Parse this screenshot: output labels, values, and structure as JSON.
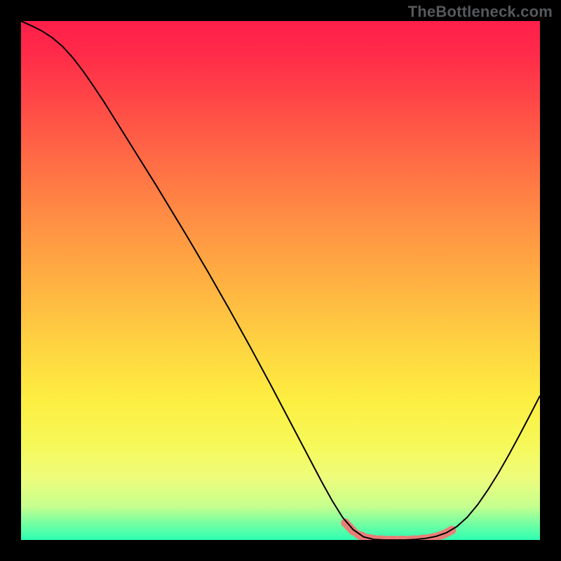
{
  "watermark": "TheBottleneck.com",
  "chart_data": {
    "type": "line",
    "title": "",
    "xlabel": "",
    "ylabel": "",
    "x": [
      0.0,
      0.02,
      0.04,
      0.06,
      0.08,
      0.1,
      0.12,
      0.14,
      0.16,
      0.18,
      0.2,
      0.22,
      0.24,
      0.26,
      0.28,
      0.3,
      0.32,
      0.34,
      0.36,
      0.38,
      0.4,
      0.42,
      0.44,
      0.46,
      0.48,
      0.5,
      0.52,
      0.54,
      0.56,
      0.58,
      0.6,
      0.62,
      0.64,
      0.66,
      0.68,
      0.7,
      0.72,
      0.74,
      0.76,
      0.78,
      0.8,
      0.82,
      0.84,
      0.86,
      0.88,
      0.9,
      0.92,
      0.94,
      0.96,
      0.98,
      1.0
    ],
    "values": [
      1.0,
      0.991,
      0.981,
      0.968,
      0.951,
      0.929,
      0.903,
      0.874,
      0.844,
      0.812,
      0.78,
      0.748,
      0.716,
      0.684,
      0.651,
      0.618,
      0.585,
      0.551,
      0.517,
      0.482,
      0.447,
      0.411,
      0.375,
      0.338,
      0.301,
      0.263,
      0.225,
      0.187,
      0.149,
      0.111,
      0.075,
      0.043,
      0.02,
      0.006,
      0.001,
      0.0,
      0.0,
      0.0,
      0.001,
      0.003,
      0.007,
      0.014,
      0.026,
      0.044,
      0.068,
      0.097,
      0.129,
      0.164,
      0.201,
      0.239,
      0.278
    ],
    "ylim": [
      0,
      1
    ],
    "xlim": [
      0,
      1
    ],
    "background_gradient": {
      "direction": "top-to-bottom",
      "stops": [
        {
          "pos": 0.0,
          "color": "#ff1f4a"
        },
        {
          "pos": 0.5,
          "color": "#ffb042"
        },
        {
          "pos": 0.82,
          "color": "#f6f95a"
        },
        {
          "pos": 1.0,
          "color": "#2dffb2"
        }
      ]
    },
    "highlight_color": "#e97e77",
    "highlight_range_x": [
      0.62,
      0.83
    ],
    "highlight_scatter": {
      "x": [
        0.625,
        0.645,
        0.665,
        0.685,
        0.705,
        0.725,
        0.745,
        0.765,
        0.785,
        0.8,
        0.815,
        0.83
      ],
      "y": [
        0.033,
        0.012,
        0.004,
        0.001,
        0.0,
        0.0,
        0.0,
        0.001,
        0.003,
        0.006,
        0.011,
        0.019
      ]
    }
  }
}
